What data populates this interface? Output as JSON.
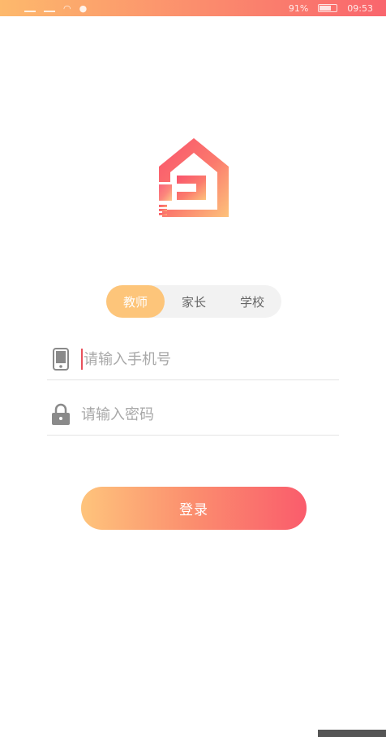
{
  "status_bar": {
    "battery_text": "91%",
    "time": "09:53"
  },
  "roles": [
    {
      "label": "教师",
      "active": true
    },
    {
      "label": "家长",
      "active": false
    },
    {
      "label": "学校",
      "active": false
    }
  ],
  "form": {
    "phone_placeholder": "请输入手机号",
    "password_placeholder": "请输入密码"
  },
  "login_button": "登录",
  "colors": {
    "accent_start": "#fec47c",
    "accent_end": "#fa5c6c",
    "active_tab": "#fdc57a"
  },
  "icons": {
    "logo": "house-logo-icon",
    "phone": "phone-icon",
    "password": "lock-icon"
  }
}
